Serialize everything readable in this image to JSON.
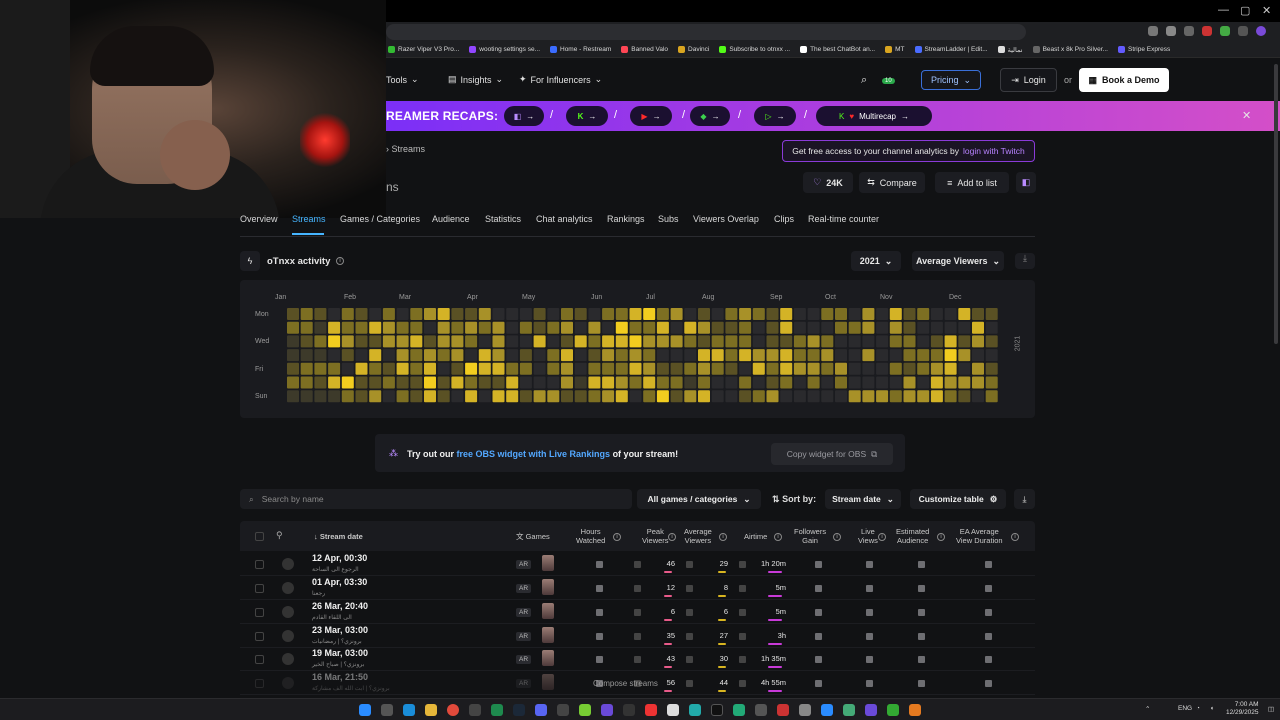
{
  "browser": {
    "bookmarks": [
      "Razer Viper V3 Pro...",
      "wooting settings se...",
      "Home - Restream",
      "Banned Valo",
      "Davinci",
      "Subscribe to otnxx ...",
      "The best ChatBot an...",
      "MT",
      "StreamLadder | Edit...",
      "نمالية",
      "Beast x 8k Pro Silver...",
      "Stripe Express"
    ]
  },
  "header": {
    "nav": [
      {
        "label": "Tools"
      },
      {
        "label": "Insights"
      },
      {
        "label": "For Influencers"
      }
    ],
    "notification_count": "10",
    "pricing_label": "Pricing",
    "login_label": "Login",
    "or_label": "or",
    "demo_label": "Book a Demo"
  },
  "recap": {
    "title": "REAMER RECAPS:",
    "multicap_label": "Multirecap"
  },
  "breadcrumb": {
    "current": "Streams",
    "subtitle": "ns"
  },
  "login_banner": {
    "text": "Get free access to your channel analytics by",
    "link": "login with Twitch"
  },
  "channel_actions": {
    "followers": "24K",
    "compare_label": "Compare",
    "add_list_label": "Add to list"
  },
  "tabs": [
    "Overview",
    "Streams",
    "Games / Categories",
    "Audience",
    "Statistics",
    "Chat analytics",
    "Rankings",
    "Subs",
    "Viewers Overlap",
    "Clips",
    "Real-time counter"
  ],
  "activity": {
    "title": "oTnxx activity",
    "year": "2021",
    "metric": "Average Viewers",
    "months": [
      "Jan",
      "Feb",
      "Mar",
      "Apr",
      "May",
      "Jun",
      "Jul",
      "Aug",
      "Sep",
      "Oct",
      "Nov",
      "Dec"
    ],
    "days": [
      "Mon",
      "Wed",
      "Fri",
      "Sun"
    ],
    "year_label": "2021"
  },
  "promo": {
    "pre": "Try out our",
    "link": "free OBS widget with Live Rankings",
    "post": "of your stream!",
    "copy_label": "Copy widget for OBS"
  },
  "filters": {
    "search_placeholder": "Search by name",
    "games_label": "All games / categories",
    "sort_label": "Sort by:",
    "sort_value": "Stream date",
    "customize_label": "Customize table"
  },
  "table": {
    "headers": {
      "stream_date": "Stream date",
      "games": "Games",
      "hours_watched": [
        "Hours",
        "Watched"
      ],
      "peak": [
        "Peak",
        "Viewers"
      ],
      "average": [
        "Average",
        "Viewers"
      ],
      "airtime": "Airtime",
      "followers": [
        "Followers",
        "Gain"
      ],
      "live_views": [
        "Live",
        "Views"
      ],
      "est_audience": [
        "Estimated",
        "Audience"
      ],
      "ea_avg": [
        "EA Average",
        "View Duration"
      ]
    },
    "rows": [
      {
        "date": "12 Apr, 00:30",
        "title": "الرجوع الى الساحة",
        "lang": "AR",
        "peak": "46",
        "avg": "29",
        "airtime": "1h 20m"
      },
      {
        "date": "01 Apr, 03:30",
        "title": "رجعنا",
        "lang": "AR",
        "peak": "12",
        "avg": "8",
        "airtime": "5m"
      },
      {
        "date": "26 Mar, 20:40",
        "title": "الى اللقاء القادم",
        "lang": "AR",
        "peak": "6",
        "avg": "6",
        "airtime": "5m"
      },
      {
        "date": "23 Mar, 03:00",
        "title": "برونزي؟ | رمضانيات",
        "lang": "AR",
        "peak": "35",
        "avg": "27",
        "airtime": "3h"
      },
      {
        "date": "19 Mar, 03:00",
        "title": "برونزي؟ | صباح الخير",
        "lang": "AR",
        "peak": "43",
        "avg": "30",
        "airtime": "1h 35m"
      },
      {
        "date": "16 Mar, 21:50",
        "title": "برونزي؟ | ابت الله الف مشاركة",
        "lang": "AR",
        "peak": "56",
        "avg": "44",
        "airtime": "4h 55m"
      }
    ],
    "compose_overlay": "Compose streams"
  },
  "taskbar": {
    "lang": "ENG",
    "time": "7:00 AM",
    "date": "12/29/2025"
  },
  "colors": {
    "accent_blue": "#46b5ff",
    "purple": "#8a3ad8",
    "heat_high": "#f2cd1f",
    "heat_low": "#4a4327"
  }
}
